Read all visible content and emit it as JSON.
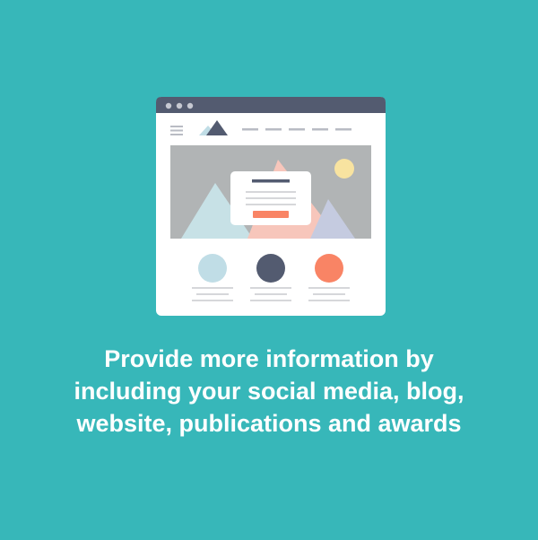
{
  "colors": {
    "background": "#37b7b9",
    "window_chrome": "#535b70",
    "window_body": "#ffffff",
    "hero_bg": "#b1b4b5",
    "mountain_light": "#c7e1e6",
    "mountain_pink": "#f7c6bb",
    "mountain_lilac": "#c5cbe0",
    "sun": "#f8e3a0",
    "cta_button": "#f98465",
    "circle_1": "#c0dde6",
    "circle_2": "#535b70",
    "circle_3": "#f98465",
    "text_lines": "#d6d7da",
    "caption_text": "#ffffff"
  },
  "caption": {
    "line1": "Provide more information by",
    "line2": "including your social media, blog,",
    "line3": "website, publications and awards"
  },
  "icons": {
    "menu": "hamburger-menu-icon",
    "logo": "mountain-logo-icon",
    "sun": "sun-icon"
  }
}
